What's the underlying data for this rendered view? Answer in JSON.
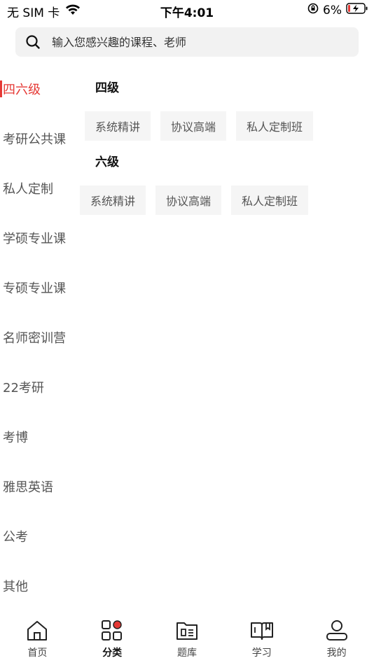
{
  "status_bar": {
    "carrier": "无 SIM 卡",
    "time": "下午4:01",
    "battery": "6%"
  },
  "search": {
    "placeholder": "输入您感兴趣的课程、老师"
  },
  "sidebar": {
    "items": [
      {
        "label": "四六级",
        "active": true
      },
      {
        "label": "考研公共课"
      },
      {
        "label": "私人定制"
      },
      {
        "label": "学硕专业课"
      },
      {
        "label": "专硕专业课"
      },
      {
        "label": "名师密训营"
      },
      {
        "label": "22考研"
      },
      {
        "label": "考博"
      },
      {
        "label": "雅思英语"
      },
      {
        "label": "公考"
      },
      {
        "label": "其他"
      }
    ]
  },
  "content": {
    "sections": [
      {
        "title": "四级",
        "chips": [
          "系统精讲",
          "协议高端",
          "私人定制班"
        ]
      },
      {
        "title": "六级",
        "chips": [
          "系统精讲",
          "协议高端",
          "私人定制班"
        ]
      }
    ]
  },
  "tab_bar": {
    "tabs": [
      {
        "label": "首页",
        "icon": "home-icon"
      },
      {
        "label": "分类",
        "icon": "category-icon",
        "active": true
      },
      {
        "label": "题库",
        "icon": "question-bank-icon"
      },
      {
        "label": "学习",
        "icon": "study-icon"
      },
      {
        "label": "我的",
        "icon": "profile-icon"
      }
    ]
  },
  "colors": {
    "accent": "#e53935",
    "search_bg": "#f2f2f2",
    "chip_bg": "#f5f5f5"
  }
}
